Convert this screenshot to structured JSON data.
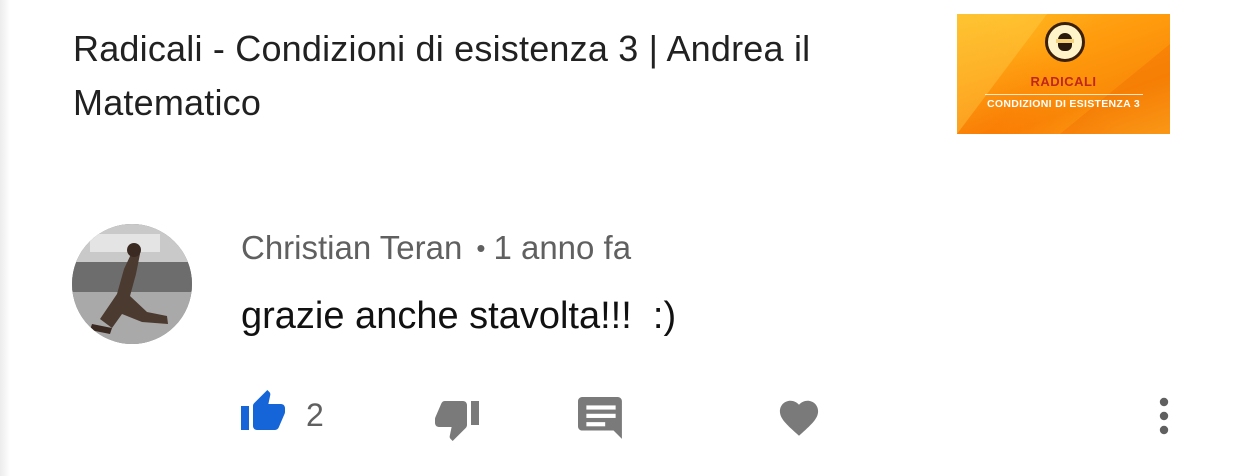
{
  "video": {
    "title": "Radicali - Condizioni di esistenza 3 | Andrea il Matematico",
    "thumbnail": {
      "title": "RADICALI",
      "subtitle": "CONDIZIONI DI ESISTENZA 3"
    }
  },
  "comment": {
    "author": "Christian Teran",
    "separator": "•",
    "time": "1 anno fa",
    "text": "grazie anche stavolta!!!  :)",
    "like_count": "2"
  },
  "actions": {
    "like_icon": "thumbs-up-icon",
    "dislike_icon": "thumbs-down-icon",
    "reply_icon": "comment-icon",
    "heart_icon": "heart-icon",
    "menu_icon": "more-vert-icon"
  },
  "colors": {
    "like_active": "#1565d8",
    "icon_inactive": "#7a7a7a",
    "thumbnail_bg": "#ffa215",
    "thumbnail_title": "#c0271b"
  }
}
